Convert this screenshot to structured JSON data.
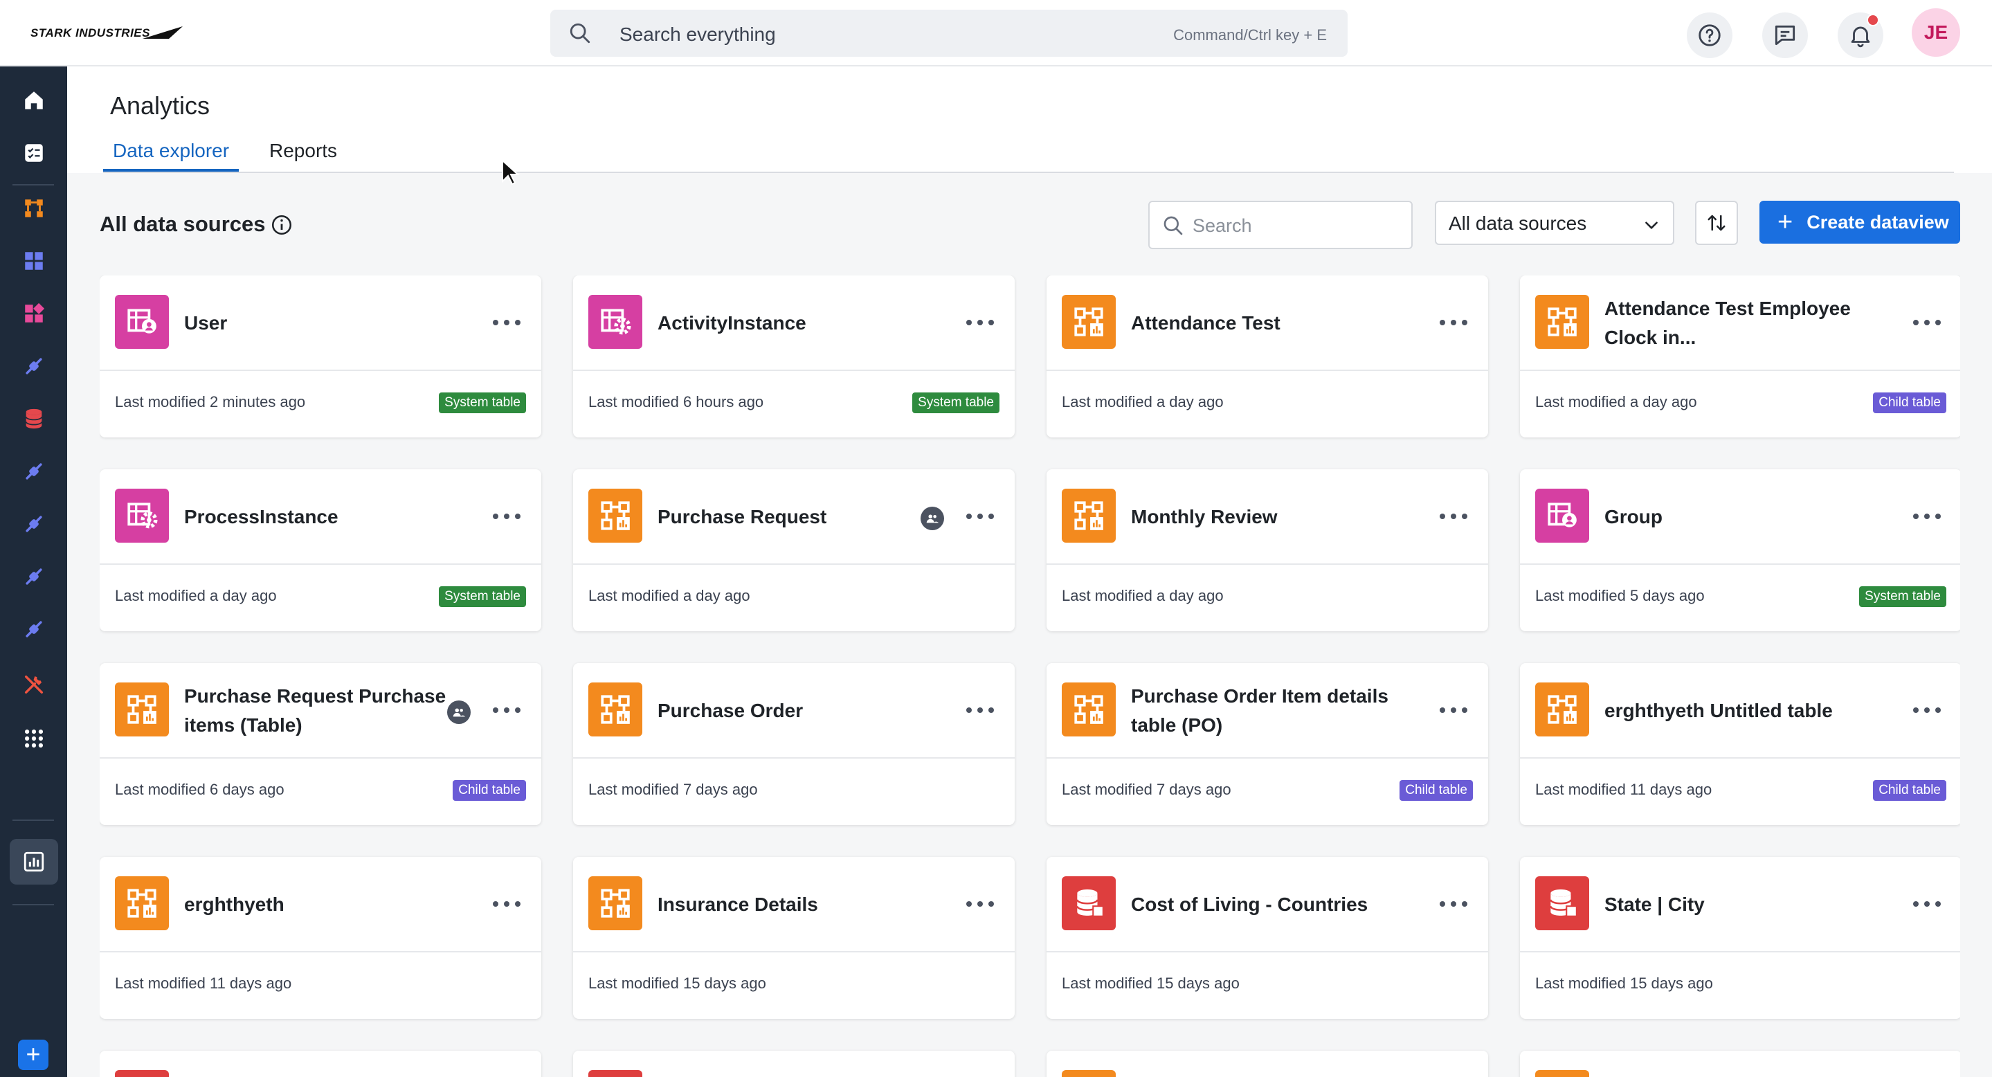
{
  "topbar": {
    "logo_text": "STARK INDUSTRIES",
    "search_placeholder": "Search everything",
    "search_hint": "Command/Ctrl key + E",
    "avatar_initials": "JE"
  },
  "colors": {
    "accent": "#1a6fe0",
    "sidebar_bg": "#1e2a3a",
    "icon_pink": "#d63fa2",
    "icon_orange": "#f38a1e",
    "icon_red": "#de3e3e",
    "badge_system": "#2e8b3e",
    "badge_child": "#6a5bd6"
  },
  "page": {
    "title": "Analytics",
    "tabs": [
      {
        "label": "Data explorer",
        "active": true
      },
      {
        "label": "Reports",
        "active": false
      }
    ]
  },
  "toolbar": {
    "section_title": "All data sources",
    "search_placeholder": "Search",
    "source_filter": "All data sources",
    "create_label": "Create dataview"
  },
  "cards": [
    {
      "name": "User",
      "icon": "system-table-user-icon",
      "color": "pink",
      "modified": "Last modified 2 minutes ago",
      "badge": "System table",
      "badge_type": "system",
      "shared": false
    },
    {
      "name": "ActivityInstance",
      "icon": "system-table-gear-icon",
      "color": "pink",
      "modified": "Last modified 6 hours ago",
      "badge": "System table",
      "badge_type": "system",
      "shared": false
    },
    {
      "name": "Attendance Test",
      "icon": "process-flow-icon",
      "color": "orange",
      "modified": "Last modified a day ago",
      "badge": "",
      "badge_type": "",
      "shared": false
    },
    {
      "name": "Attendance Test Employee Clock in...",
      "icon": "process-flow-icon",
      "color": "orange",
      "modified": "Last modified a day ago",
      "badge": "Child table",
      "badge_type": "child",
      "shared": false
    },
    {
      "name": "ProcessInstance",
      "icon": "system-table-gear-icon",
      "color": "pink",
      "modified": "Last modified a day ago",
      "badge": "System table",
      "badge_type": "system",
      "shared": false
    },
    {
      "name": "Purchase Request",
      "icon": "process-flow-icon",
      "color": "orange",
      "modified": "Last modified a day ago",
      "badge": "",
      "badge_type": "",
      "shared": true
    },
    {
      "name": "Monthly Review",
      "icon": "process-flow-icon",
      "color": "orange",
      "modified": "Last modified a day ago",
      "badge": "",
      "badge_type": "",
      "shared": false
    },
    {
      "name": "Group",
      "icon": "system-table-user-icon",
      "color": "pink",
      "modified": "Last modified 5 days ago",
      "badge": "System table",
      "badge_type": "system",
      "shared": false
    },
    {
      "name": "Purchase Request Purchase items (Table)",
      "icon": "process-flow-icon",
      "color": "orange",
      "modified": "Last modified 6 days ago",
      "badge": "Child table",
      "badge_type": "child",
      "shared": true
    },
    {
      "name": "Purchase Order",
      "icon": "process-flow-icon",
      "color": "orange",
      "modified": "Last modified 7 days ago",
      "badge": "",
      "badge_type": "",
      "shared": false
    },
    {
      "name": "Purchase Order Item details table (PO)",
      "icon": "process-flow-icon",
      "color": "orange",
      "modified": "Last modified 7 days ago",
      "badge": "Child table",
      "badge_type": "child",
      "shared": false
    },
    {
      "name": "erghthyeth Untitled table",
      "icon": "process-flow-icon",
      "color": "orange",
      "modified": "Last modified 11 days ago",
      "badge": "Child table",
      "badge_type": "child",
      "shared": false
    },
    {
      "name": "erghthyeth",
      "icon": "process-flow-icon",
      "color": "orange",
      "modified": "Last modified 11 days ago",
      "badge": "",
      "badge_type": "",
      "shared": false
    },
    {
      "name": "Insurance Details",
      "icon": "process-flow-icon",
      "color": "orange",
      "modified": "Last modified 15 days ago",
      "badge": "",
      "badge_type": "",
      "shared": false
    },
    {
      "name": "Cost of Living - Countries",
      "icon": "database-icon",
      "color": "red",
      "modified": "Last modified 15 days ago",
      "badge": "",
      "badge_type": "",
      "shared": false
    },
    {
      "name": "State | City",
      "icon": "database-icon",
      "color": "red",
      "modified": "Last modified 15 days ago",
      "badge": "",
      "badge_type": "",
      "shared": false
    }
  ],
  "partial_cards": [
    {
      "color": "red"
    },
    {
      "color": "red"
    },
    {
      "color": "orange"
    },
    {
      "color": "orange"
    }
  ]
}
